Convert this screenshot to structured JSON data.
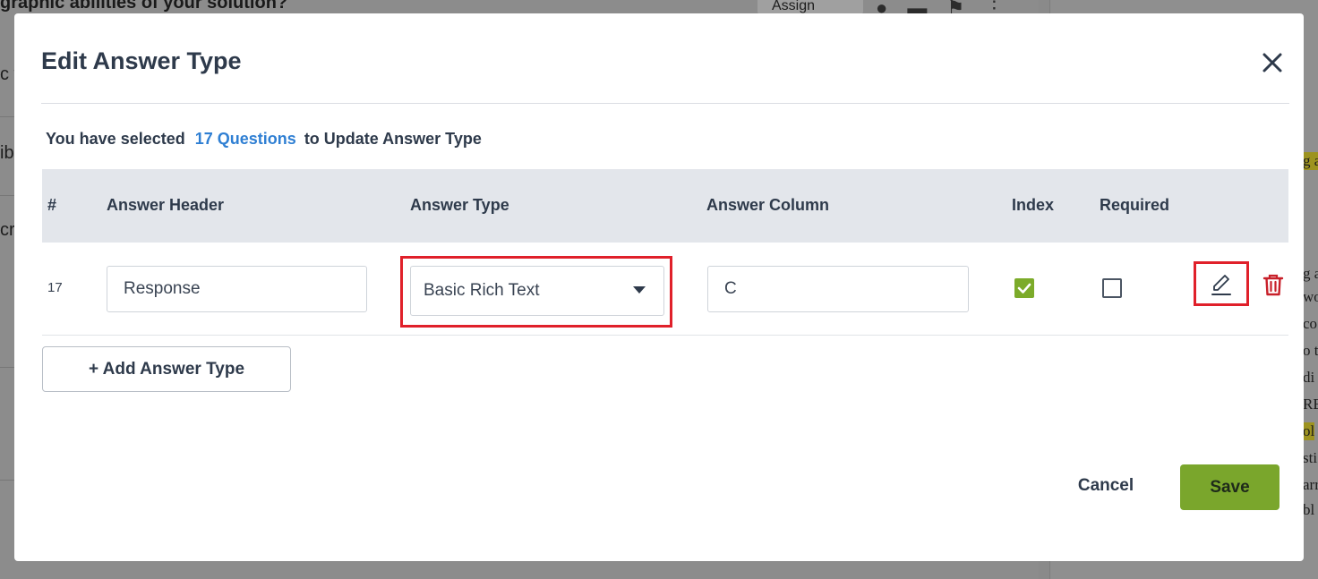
{
  "background": {
    "question_text": "graphic abilities of your solution?",
    "assign_label": "Assign",
    "left_fragments": [
      "c f",
      "ib",
      "cr"
    ],
    "right_fragments": [
      "g a",
      "wo",
      "co",
      "o t",
      "di",
      "RE",
      "ol",
      "sti",
      "arr",
      "bl"
    ]
  },
  "modal": {
    "title": "Edit Answer Type",
    "close_icon": "close-icon",
    "selection": {
      "prefix": "You have selected",
      "link_text": "17 Questions",
      "suffix": "to Update Answer Type"
    },
    "table": {
      "headers": {
        "num": "#",
        "answer_header": "Answer Header",
        "answer_type": "Answer Type",
        "answer_column": "Answer Column",
        "index": "Index",
        "required": "Required"
      },
      "rows": [
        {
          "num": "17",
          "answer_header": "Response",
          "answer_type": "Basic Rich Text",
          "answer_column": "C",
          "index": true,
          "required": false
        }
      ]
    },
    "add_button": "+ Add Answer Type",
    "cancel_button": "Cancel",
    "save_button": "Save"
  },
  "colors": {
    "accent_blue": "#2f7fd3",
    "save_green": "#7aa62c",
    "check_green": "#7cab2a",
    "highlight_red": "#e0202a",
    "delete_red": "#c8202a"
  }
}
